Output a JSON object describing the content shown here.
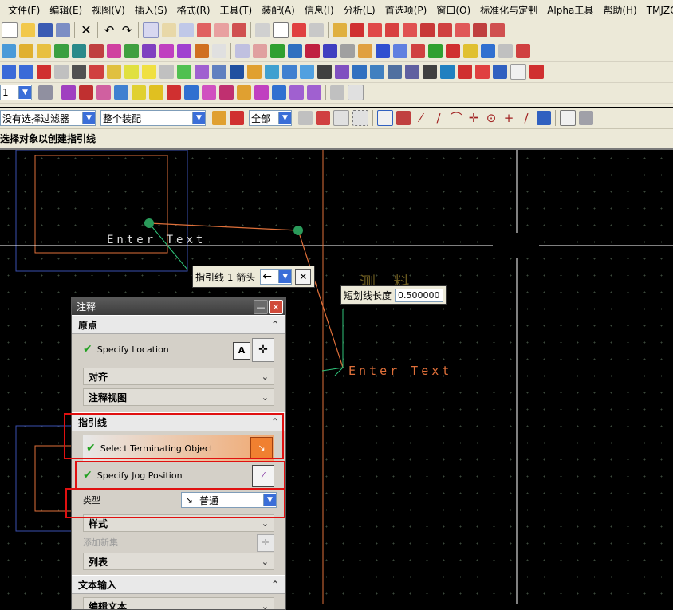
{
  "menu": [
    "文件(F)",
    "编辑(E)",
    "视图(V)",
    "插入(S)",
    "格式(R)",
    "工具(T)",
    "装配(A)",
    "信息(I)",
    "分析(L)",
    "首选项(P)",
    "窗口(O)",
    "标准化与定制",
    "Alpha工具",
    "帮助(H)",
    "TMJZCY"
  ],
  "toolbar": {
    "layer_value": "1",
    "filter_value": "没有选择过滤器",
    "scope_value": "整个装配",
    "all_value": "全部"
  },
  "cue_line": "选择对象以创建指引线",
  "canvas": {
    "note_text_1": "Enter Text",
    "note_text_2": "Enter Text",
    "ghost_text": "测 料"
  },
  "popup_arrow": {
    "label": "指引线 1 箭头",
    "arrow_glyph": "←",
    "close_glyph": "✕"
  },
  "popup_jog": {
    "label": "短划线长度",
    "value": "0.500000"
  },
  "dialog": {
    "title": "注释",
    "sections": {
      "origin": {
        "title": "原点",
        "specify_location": "Specify Location",
        "align": "对齐",
        "annotation_view": "注释视图"
      },
      "leader": {
        "title": "指引线",
        "select_terminating": "Select Terminating Object",
        "specify_jog": "Specify Jog Position",
        "type_label": "类型",
        "type_value": "普通",
        "style": "样式",
        "add_new_set": "添加新集",
        "list": "列表"
      },
      "text_input": {
        "title": "文本输入",
        "edit_text": "编辑文本"
      }
    }
  },
  "colors": {
    "ui_bg": "#ece9d8",
    "canvas_bg": "#000000",
    "orange_geom": "#e0703a",
    "blue_geom": "#3a4fb0",
    "green_geom": "#2fc47a",
    "highlight_red": "#e01010"
  }
}
